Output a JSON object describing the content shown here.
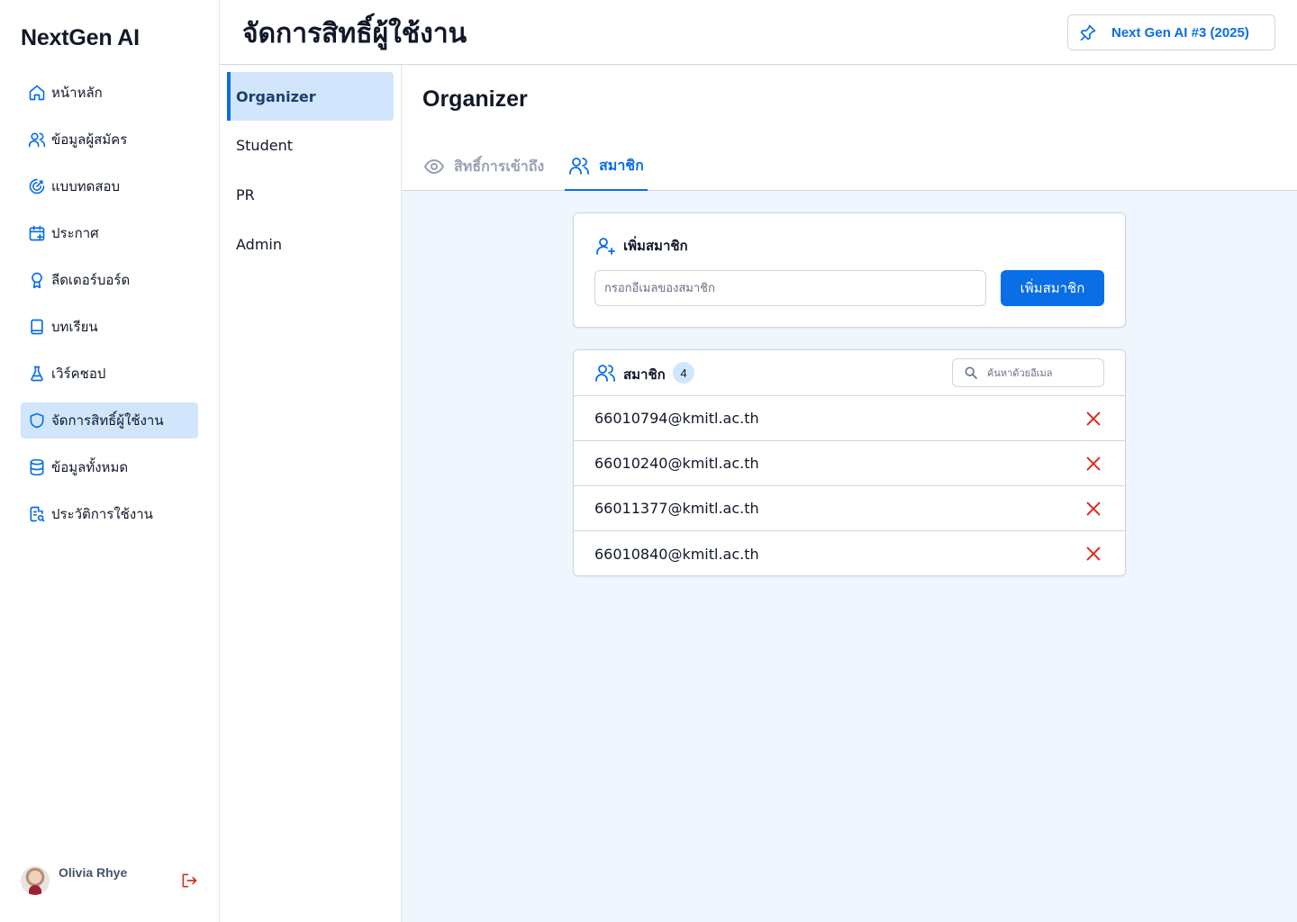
{
  "app": {
    "brand": "NextGen AI"
  },
  "sidebar": {
    "items": [
      {
        "label": "หน้าหลัก",
        "icon": "home-icon"
      },
      {
        "label": "ข้อมูลผู้สมัคร",
        "icon": "users-icon"
      },
      {
        "label": "แบบทดสอบ",
        "icon": "target-icon"
      },
      {
        "label": "ประกาศ",
        "icon": "calendar-plus-icon"
      },
      {
        "label": "ลีดเดอร์บอร์ด",
        "icon": "award-icon"
      },
      {
        "label": "บทเรียน",
        "icon": "book-icon"
      },
      {
        "label": "เวิร์คชอป",
        "icon": "flask-icon"
      },
      {
        "label": "จัดการสิทธิ์ผู้ใช้งาน",
        "icon": "shield-icon",
        "active": true
      },
      {
        "label": "ข้อมูลทั้งหมด",
        "icon": "database-icon"
      },
      {
        "label": "ประวัติการใช้งาน",
        "icon": "file-search-icon"
      }
    ],
    "user": {
      "name": "Olivia Rhye"
    }
  },
  "header": {
    "title": "จัดการสิทธิ์ผู้ใช้งาน",
    "event_label": "Next Gen AI #3 (2025)"
  },
  "roles": {
    "items": [
      "Organizer",
      "Student",
      "PR",
      "Admin"
    ],
    "selected": "Organizer"
  },
  "main": {
    "role_title": "Organizer",
    "tabs": [
      {
        "label": "สิทธิ์การเข้าถึง",
        "icon": "eye-icon"
      },
      {
        "label": "สมาชิก",
        "icon": "users-icon",
        "active": true
      }
    ]
  },
  "add_member": {
    "title": "เพิ่มสมาชิก",
    "input_placeholder": "กรอกอีเมลของสมาชิก",
    "input_value": "",
    "button_label": "เพิ่มสมาชิก"
  },
  "members": {
    "title": "สมาชิก",
    "count": "4",
    "search_placeholder": "ค้นหาด้วยอีเมล",
    "list": [
      {
        "email": "66010794@kmitl.ac.th"
      },
      {
        "email": "66010240@kmitl.ac.th"
      },
      {
        "email": "66011377@kmitl.ac.th"
      },
      {
        "email": "66010840@kmitl.ac.th"
      }
    ]
  },
  "colors": {
    "accent": "#0a6ee6",
    "active_bg": "#d1e6fd",
    "danger": "#d92d20",
    "content_bg": "#eff6fe"
  }
}
